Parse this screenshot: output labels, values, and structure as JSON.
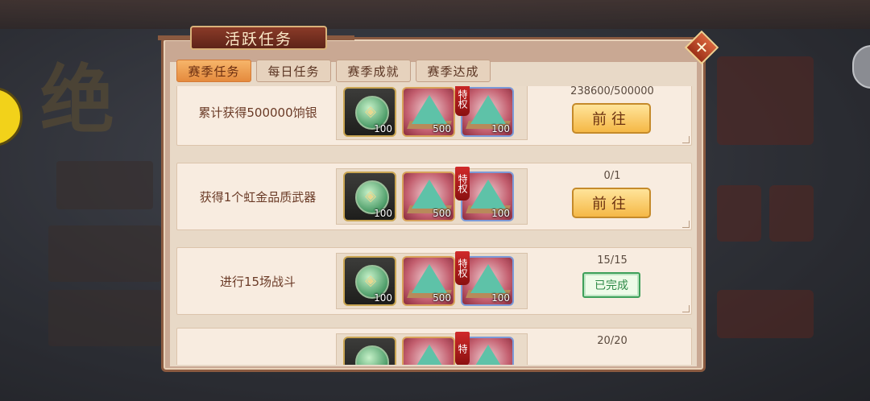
{
  "panel": {
    "title": "活跃任务",
    "close_symbol": "✕"
  },
  "tabs": [
    {
      "label": "赛季任务",
      "active": true
    },
    {
      "label": "每日任务",
      "active": false
    },
    {
      "label": "赛季成就",
      "active": false
    },
    {
      "label": "赛季达成",
      "active": false
    }
  ],
  "tasks": [
    {
      "name": "累计获得500000饷银",
      "progress": "238600/500000",
      "action": "前往",
      "status": "in_progress",
      "rewards": [
        {
          "icon": "jade-token-icon",
          "quantity": "100"
        },
        {
          "icon": "jade-mound-icon",
          "quantity": "500"
        },
        {
          "icon": "jade-mound-icon",
          "quantity": "100",
          "badge": "特权"
        }
      ]
    },
    {
      "name": "获得1个虹金品质武器",
      "progress": "0/1",
      "action": "前往",
      "status": "in_progress",
      "rewards": [
        {
          "icon": "jade-token-icon",
          "quantity": "100"
        },
        {
          "icon": "jade-mound-icon",
          "quantity": "500"
        },
        {
          "icon": "jade-mound-icon",
          "quantity": "100",
          "badge": "特权"
        }
      ]
    },
    {
      "name": "进行15场战斗",
      "progress": "15/15",
      "action": "已完成",
      "status": "completed",
      "rewards": [
        {
          "icon": "jade-token-icon",
          "quantity": "100"
        },
        {
          "icon": "jade-mound-icon",
          "quantity": "500"
        },
        {
          "icon": "jade-mound-icon",
          "quantity": "100",
          "badge": "特权"
        }
      ]
    },
    {
      "name": "",
      "progress": "20/20",
      "rewards": [
        {
          "icon": "jade-token-icon",
          "quantity": ""
        },
        {
          "icon": "jade-mound-icon",
          "quantity": ""
        },
        {
          "icon": "jade-mound-icon",
          "quantity": "",
          "badge": "特"
        }
      ]
    }
  ],
  "colors": {
    "accent_orange": "#e58b3e",
    "button_gold": "#f5b846",
    "complete_green": "#2f8a48",
    "privilege_red": "#d02a2a"
  }
}
